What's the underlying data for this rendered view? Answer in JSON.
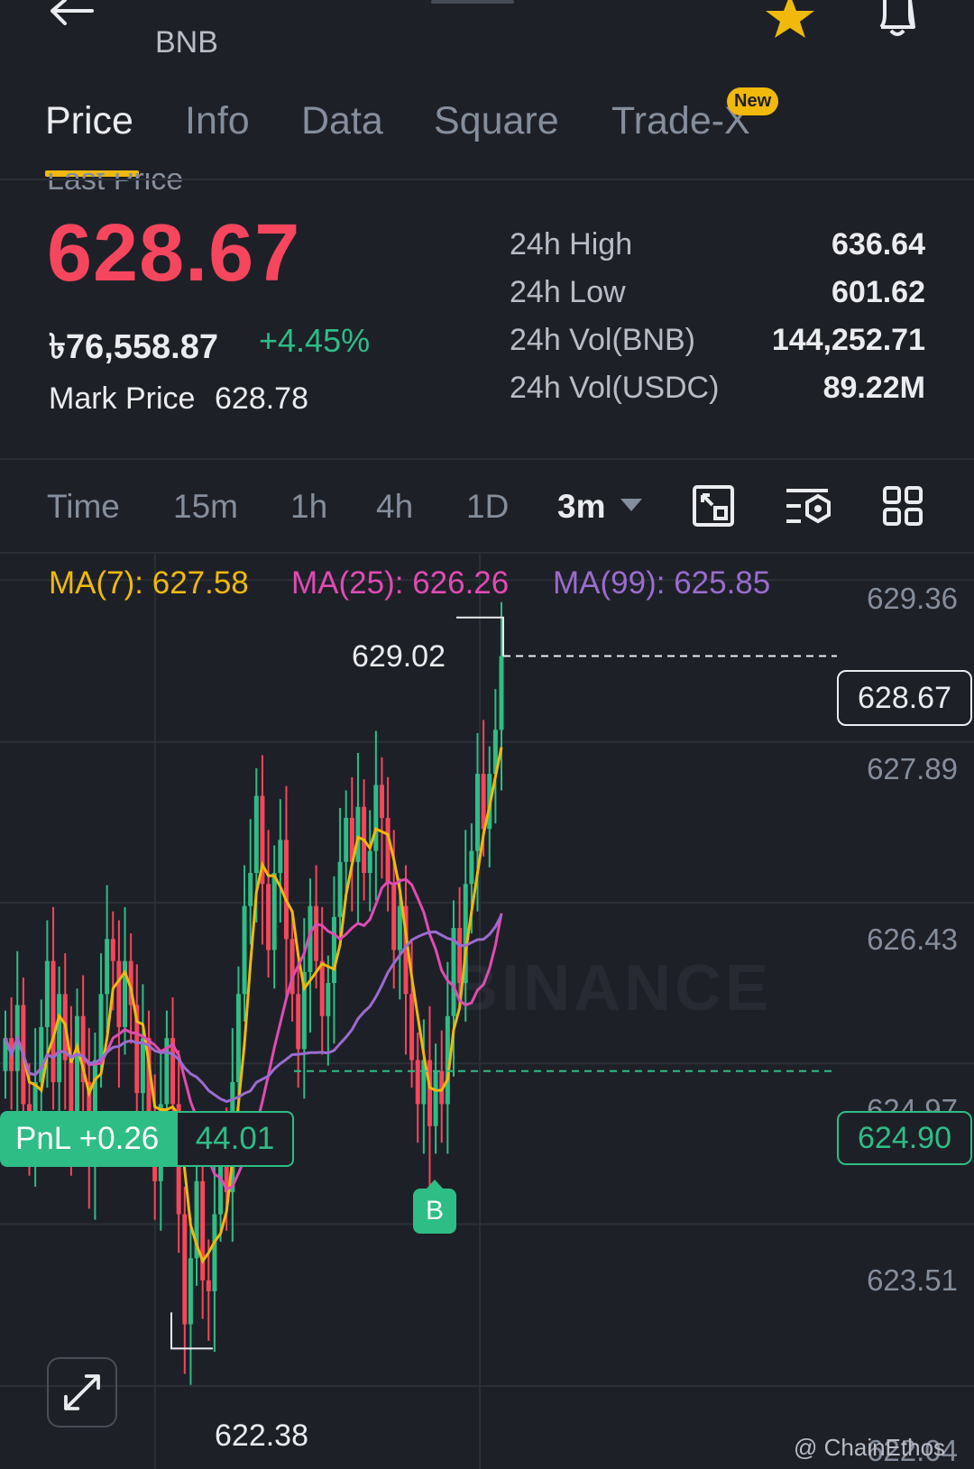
{
  "header": {
    "symbol": "BNB",
    "icons": [
      "back-arrow-icon",
      "star-icon",
      "bell-icon"
    ],
    "star_color": "#f0b90b"
  },
  "tabs": [
    {
      "label": "Price",
      "active": true
    },
    {
      "label": "Info"
    },
    {
      "label": "Data"
    },
    {
      "label": "Square"
    },
    {
      "label": "Trade-X",
      "badge": "New"
    }
  ],
  "price": {
    "price_type_label": "Last Price",
    "last": "628.67",
    "fiat": "৳76,558.87",
    "change_pct": "+4.45%",
    "mark_label": "Mark Price",
    "mark_value": "628.78",
    "up_color": "#2ebd85",
    "down_color": "#f6465d"
  },
  "stats": [
    {
      "label": "24h High",
      "value": "636.64"
    },
    {
      "label": "24h Low",
      "value": "601.62"
    },
    {
      "label": "24h Vol(BNB)",
      "value": "144,252.71"
    },
    {
      "label": "24h Vol(USDC)",
      "value": "89.22M"
    }
  ],
  "intervals": [
    {
      "label": "Time"
    },
    {
      "label": "15m"
    },
    {
      "label": "1h"
    },
    {
      "label": "4h"
    },
    {
      "label": "1D"
    },
    {
      "label": "3m",
      "active": true
    }
  ],
  "toolbar_icons": [
    "chart-type-icon",
    "indicator-settings-icon",
    "grid-layout-icon"
  ],
  "ma": [
    {
      "label": "MA(7): 627.58",
      "color": "#f0b90b"
    },
    {
      "label": "MA(25): 626.26",
      "color": "#e04bb2"
    },
    {
      "label": "MA(99): 625.85",
      "color": "#9a6ccf"
    }
  ],
  "chart_overlays": {
    "high_marker": "629.02",
    "low_marker": "622.38",
    "current_price": "628.67",
    "entry_price": "624.90",
    "pnl_label": "PnL +0.26",
    "position_qty": "44.01",
    "buy_marker": "B",
    "watermark": "BINANCE",
    "credit": "@ ChainEthos"
  },
  "chart_data": {
    "type": "candlestick",
    "y_ticks": [
      "629.36",
      "627.89",
      "626.43",
      "624.97",
      "623.51",
      "622.04"
    ],
    "ylim": [
      621.9,
      629.6
    ],
    "current_price": 628.67,
    "entry_price": 624.9,
    "high": 629.02,
    "low": 622.38,
    "close": [
      625.2,
      624.9,
      625.5,
      624.6,
      624.2,
      624.8,
      625.3,
      625.9,
      624.8,
      625.6,
      625.0,
      624.5,
      625.4,
      624.8,
      624.1,
      625.0,
      625.6,
      626.1,
      625.9,
      625.3,
      625.9,
      625.5,
      624.7,
      625.2,
      624.5,
      623.9,
      624.6,
      625.2,
      624.6,
      623.6,
      622.6,
      623.2,
      623.9,
      623.0,
      622.9,
      623.6,
      624.2,
      623.8,
      624.8,
      625.6,
      626.4,
      626.7,
      627.4,
      626.6,
      626.0,
      626.7,
      627.0,
      626.1,
      625.6,
      625.1,
      625.8,
      626.4,
      625.9,
      625.4,
      625.7,
      626.3,
      626.8,
      627.2,
      626.8,
      627.3,
      626.7,
      626.9,
      627.5,
      627.2,
      626.6,
      626.0,
      626.4,
      625.6,
      625.0,
      624.6,
      625.0,
      624.4,
      624.9,
      624.6,
      625.4,
      626.2,
      625.7,
      626.6,
      626.9,
      627.6,
      627.1,
      627.6,
      628.0,
      628.67
    ],
    "ma7": [
      627.58
    ],
    "ma25": [
      626.26
    ],
    "ma99": [
      625.85
    ]
  }
}
